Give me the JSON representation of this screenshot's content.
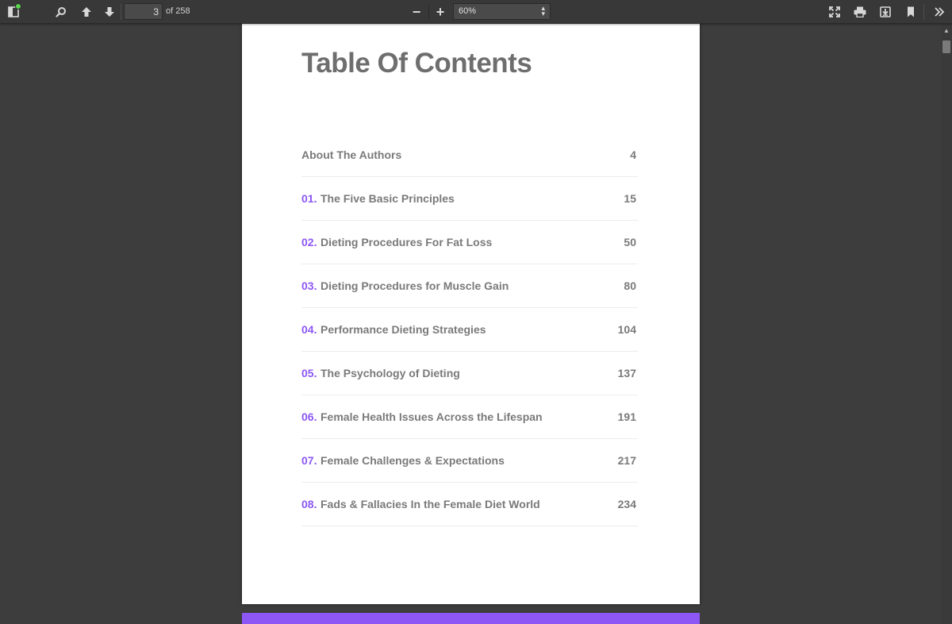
{
  "toolbar": {
    "page_value": "3",
    "page_count": "of 258",
    "zoom_label": "60%",
    "zoom_minus": "−",
    "zoom_plus": "+"
  },
  "document": {
    "title": "Table Of Contents",
    "entries": [
      {
        "number": "",
        "label": "About The Authors",
        "page": "4"
      },
      {
        "number": "01.",
        "label": "The Five Basic Principles",
        "page": "15"
      },
      {
        "number": "02.",
        "label": "Dieting Procedures For Fat Loss",
        "page": "50"
      },
      {
        "number": "03.",
        "label": "Dieting Procedures for Muscle Gain",
        "page": "80"
      },
      {
        "number": "04.",
        "label": "Performance Dieting Strategies",
        "page": "104"
      },
      {
        "number": "05.",
        "label": "The Psychology of Dieting",
        "page": "137"
      },
      {
        "number": "06.",
        "label": "Female Health Issues Across the Lifespan",
        "page": "191"
      },
      {
        "number": "07.",
        "label": "Female Challenges & Expectations",
        "page": "217"
      },
      {
        "number": "08.",
        "label": "Fads & Fallacies In the Female Diet World",
        "page": "234"
      }
    ]
  },
  "icons": {
    "sidebar_toggle": "sidebar-toggle-icon",
    "search": "search-icon",
    "prev_page": "arrow-up-icon",
    "next_page": "arrow-down-icon",
    "presentation": "fullscreen-icon",
    "print": "print-icon",
    "download": "download-icon",
    "bookmark": "bookmark-icon",
    "tools": "double-chevron-right-icon"
  },
  "colors": {
    "accent": "#8c57f5",
    "toolbar_bg": "#383838",
    "viewer_bg": "#3d3d3d",
    "text_gray": "#7a7a7a",
    "notification_dot": "#5bd54f"
  }
}
